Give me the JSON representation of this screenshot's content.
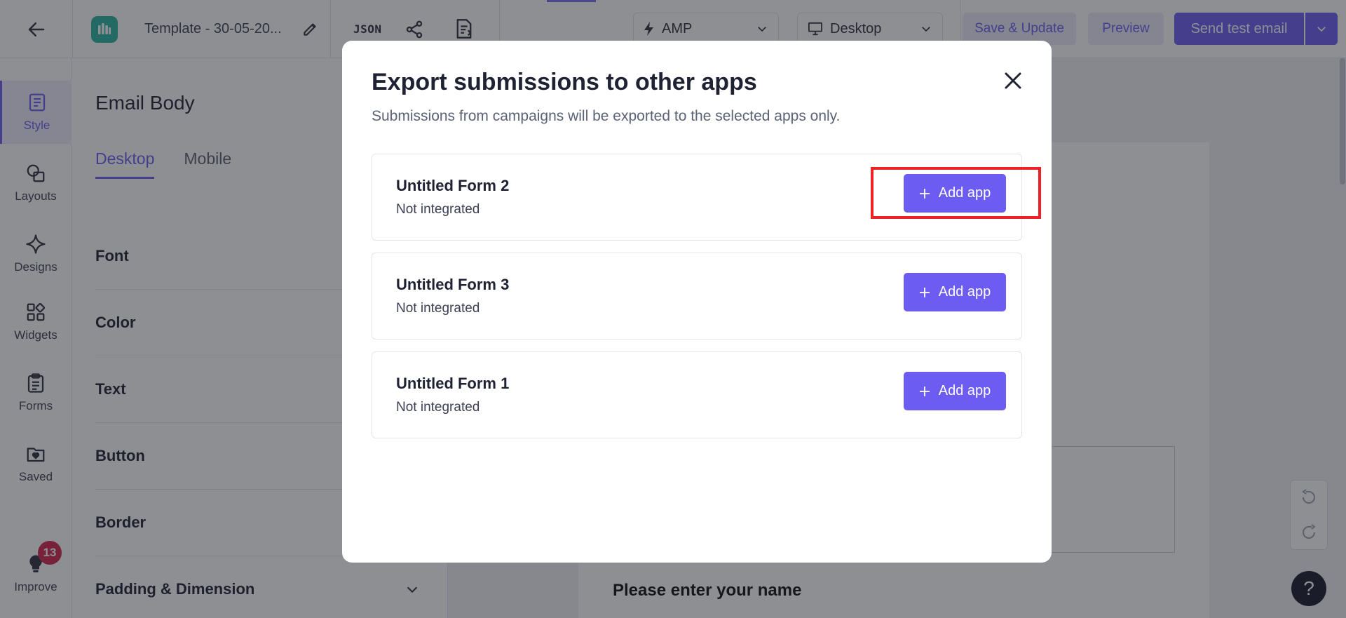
{
  "header": {
    "template_name": "Template - 30-05-20...",
    "json_label": "JSON",
    "amp_dropdown": "AMP",
    "device_dropdown": "Desktop",
    "save_update_label": "Save & Update",
    "preview_label": "Preview",
    "send_test_label": "Send test email"
  },
  "rail": {
    "items": [
      {
        "label": "Style",
        "icon": "style-icon"
      },
      {
        "label": "Layouts",
        "icon": "layouts-icon"
      },
      {
        "label": "Designs",
        "icon": "designs-icon"
      },
      {
        "label": "Widgets",
        "icon": "widgets-icon"
      },
      {
        "label": "Forms",
        "icon": "forms-icon"
      },
      {
        "label": "Saved",
        "icon": "saved-icon"
      },
      {
        "label": "Improve",
        "icon": "bulb-icon"
      }
    ],
    "improve_badge": "13"
  },
  "panel": {
    "title": "Email Body",
    "tabs": [
      "Desktop",
      "Mobile"
    ],
    "sections": [
      "Font",
      "Color",
      "Text",
      "Button",
      "Border",
      "Padding & Dimension"
    ]
  },
  "canvas": {
    "name_prompt": "Please enter your name",
    "help_label": "?"
  },
  "modal": {
    "title": "Export submissions to other apps",
    "subtitle": "Submissions from campaigns will be exported to the selected apps only.",
    "forms": [
      {
        "name": "Untitled Form  2",
        "status": "Not integrated",
        "button": "Add app"
      },
      {
        "name": "Untitled Form  3",
        "status": "Not integrated",
        "button": "Add app"
      },
      {
        "name": "Untitled Form  1",
        "status": "Not integrated",
        "button": "Add app"
      }
    ]
  },
  "colors": {
    "primary": "#6c5cf2",
    "overlay": "rgba(30,32,40,0.5)",
    "highlight": "#ec2227",
    "badge": "#d1234f"
  }
}
